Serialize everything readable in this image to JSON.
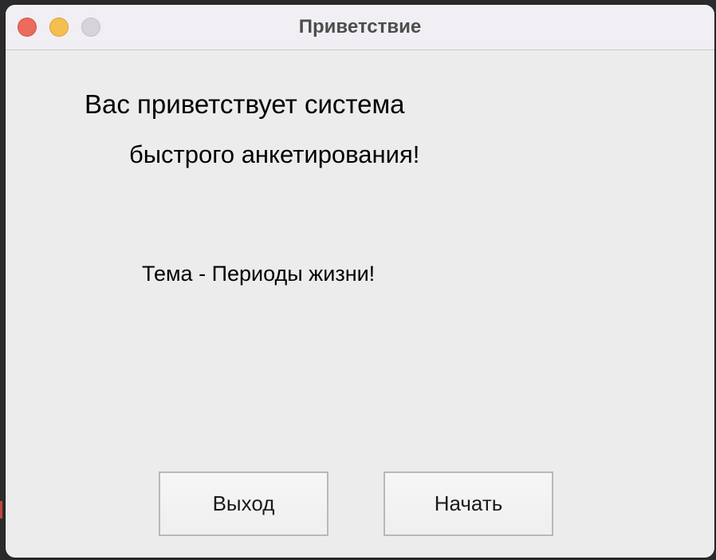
{
  "window": {
    "title": "Приветствие"
  },
  "content": {
    "welcome_line1": "Вас приветствует система",
    "welcome_line2": "быстрого анкетирования!",
    "topic": "Тема - Периоды жизни!"
  },
  "buttons": {
    "exit_label": "Выход",
    "start_label": "Начать"
  },
  "colors": {
    "close": "#ed6a5e",
    "minimize": "#f5bf4f",
    "zoom_disabled": "#d6d4d9",
    "window_bg": "#ececec"
  }
}
